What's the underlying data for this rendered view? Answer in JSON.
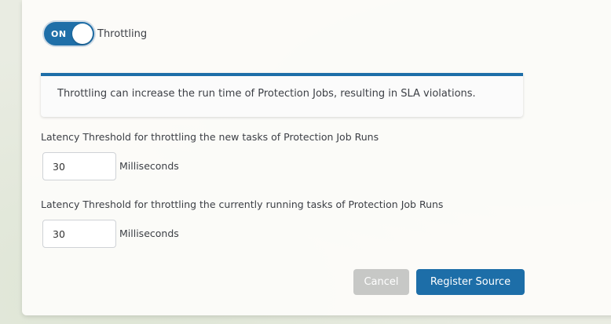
{
  "throttling": {
    "toggle_state": "ON",
    "label": "Throttling"
  },
  "banner": {
    "message": "Throttling can increase the run time of Protection Jobs, resulting in SLA violations."
  },
  "new_tasks": {
    "label": "Latency Threshold for throttling the new tasks of Protection Job Runs",
    "value": "30",
    "unit": "Milliseconds"
  },
  "running_tasks": {
    "label": "Latency Threshold for throttling the currently running tasks of Protection Job Runs",
    "value": "30",
    "unit": "Milliseconds"
  },
  "actions": {
    "cancel_label": "Cancel",
    "submit_label": "Register Source"
  },
  "colors": {
    "accent": "#1d6ea8",
    "cancel": "#c7c8c6"
  }
}
